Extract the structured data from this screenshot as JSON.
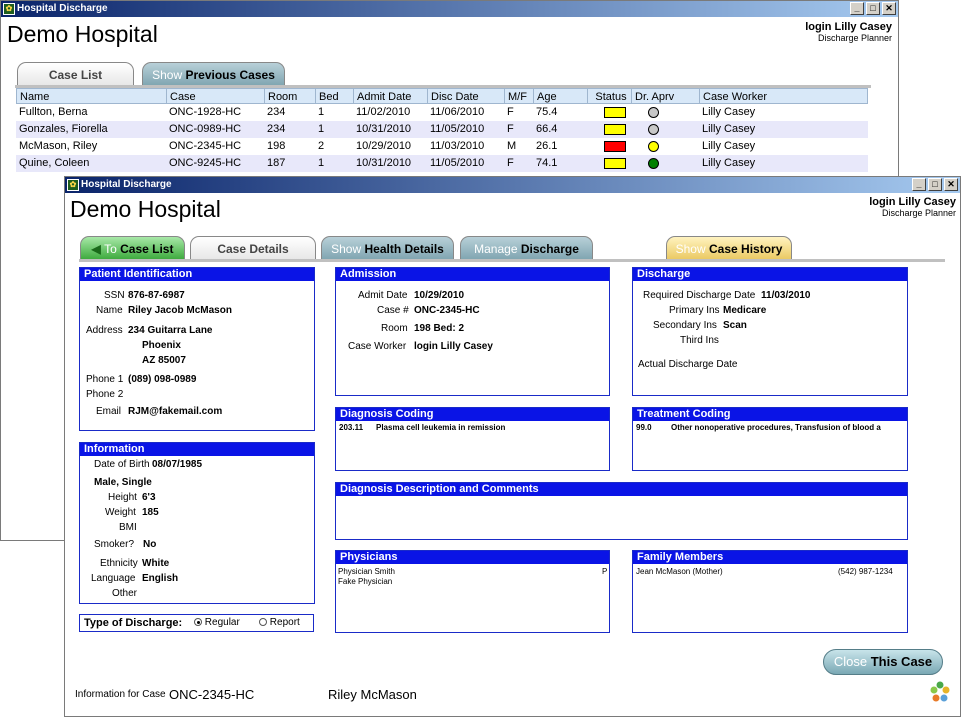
{
  "back_window": {
    "title": "Hospital Discharge",
    "app_name": "Demo Hospital",
    "login": "login Lilly Casey",
    "role": "Discharge Planner",
    "tabs": {
      "case_list": "Case List",
      "prev_pre": "Show",
      "prev_main": "Previous Cases"
    },
    "table": {
      "columns": [
        "Name",
        "Case",
        "Room",
        "Bed",
        "Admit Date",
        "Disc Date",
        "M/F",
        "Age",
        "Status",
        "Dr. Aprv",
        "Case Worker"
      ],
      "rows": [
        {
          "name": "Fullton, Berna",
          "case": "ONC-1928-HC",
          "room": "234",
          "bed": "1",
          "admit": "11/02/2010",
          "disc": "11/06/2010",
          "mf": "F",
          "age": "75.4",
          "status_color": "#ffff00",
          "aprv_color": "#c8c8c8",
          "worker": "Lilly Casey"
        },
        {
          "name": "Gonzales, Fiorella",
          "case": "ONC-0989-HC",
          "room": "234",
          "bed": "1",
          "admit": "10/31/2010",
          "disc": "11/05/2010",
          "mf": "F",
          "age": "66.4",
          "status_color": "#ffff00",
          "aprv_color": "#c8c8c8",
          "worker": "Lilly Casey"
        },
        {
          "name": "McMason, Riley",
          "case": "ONC-2345-HC",
          "room": "198",
          "bed": "2",
          "admit": "10/29/2010",
          "disc": "11/03/2010",
          "mf": "M",
          "age": "26.1",
          "status_color": "#ff0000",
          "aprv_color": "#ffff00",
          "worker": "Lilly Casey"
        },
        {
          "name": "Quine, Coleen",
          "case": "ONC-9245-HC",
          "room": "187",
          "bed": "1",
          "admit": "10/31/2010",
          "disc": "11/05/2010",
          "mf": "F",
          "age": "74.1",
          "status_color": "#ffff00",
          "aprv_color": "#008000",
          "worker": "Lilly Casey"
        }
      ]
    }
  },
  "front_window": {
    "title": "Hospital Discharge",
    "app_name": "Demo Hospital",
    "login": "login Lilly Casey",
    "role": "Discharge Planner",
    "tabs": {
      "to_pre": "To",
      "to_main": "Case List",
      "case_details": "Case Details",
      "health_pre": "Show",
      "health_main": "Health Details",
      "manage_pre": "Manage",
      "manage_main": "Discharge",
      "history_pre": "Show",
      "history_main": "Case History"
    },
    "patient": {
      "header": "Patient Identification",
      "ssn_label": "SSN",
      "ssn": "876-87-6987",
      "name_label": "Name",
      "name": "Riley Jacob McMason",
      "address_label": "Address",
      "address1": "234 Guitarra Lane",
      "city": "Phoenix",
      "state_zip": "AZ  85007",
      "phone1_label": "Phone 1",
      "phone1": "(089) 098-0989",
      "phone2_label": "Phone 2",
      "email_label": "Email",
      "email": "RJM@fakemail.com"
    },
    "information": {
      "header": "Information",
      "dob_label": "Date of Birth",
      "dob": "08/07/1985",
      "gender_status": "Male, Single",
      "height_label": "Height",
      "height": "6'3",
      "weight_label": "Weight",
      "weight": "185",
      "bmi_label": "BMI",
      "smoker_label": "Smoker?",
      "smoker": "No",
      "ethnicity_label": "Ethnicity",
      "ethnicity": "White",
      "language_label": "Language",
      "language": "English",
      "other_label": "Other"
    },
    "discharge_type": {
      "label": "Type of Discharge:",
      "regular": "Regular",
      "report": "Report"
    },
    "admission": {
      "header": "Admission",
      "admit_label": "Admit Date",
      "admit": "10/29/2010",
      "case_label": "Case #",
      "case": "ONC-2345-HC",
      "room_label": "Room",
      "room": "198  Bed: 2",
      "worker_label": "Case Worker",
      "worker": "login Lilly Casey"
    },
    "discharge": {
      "header": "Discharge",
      "required_label": "Required Discharge Date",
      "required": "11/03/2010",
      "primary_label": "Primary Ins",
      "primary": "Medicare",
      "secondary_label": "Secondary Ins",
      "secondary": "Scan",
      "third_label": "Third Ins",
      "actual_label": "Actual Discharge Date"
    },
    "diagnosis_coding": {
      "header": "Diagnosis Coding",
      "code": "203.11",
      "desc": "Plasma cell leukemia in remission"
    },
    "treatment_coding": {
      "header": "Treatment Coding",
      "code": "99.0",
      "desc": "Other nonoperative procedures, Transfusion of blood a"
    },
    "diag_desc": {
      "header": "Diagnosis Description and Comments"
    },
    "physicians": {
      "header": "Physicians",
      "p1": "Physician Smith",
      "p1_flag": "P",
      "p2": "Fake Physician"
    },
    "family": {
      "header": "Family Members",
      "member": "Jean McMason (Mother)",
      "phone": "(542) 987-1234"
    },
    "close": {
      "pre": "Close",
      "main": "This Case"
    },
    "footer": {
      "label": "Information for Case",
      "case": "ONC-2345-HC",
      "patient": "Riley McMason"
    }
  }
}
